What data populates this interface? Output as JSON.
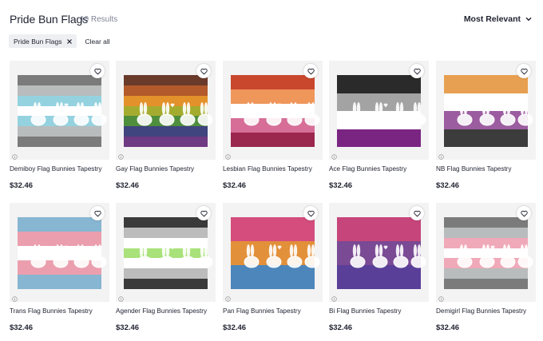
{
  "header": {
    "title": "Pride Bun Flags",
    "results": "10 Results",
    "sort_label": "Most Relevant"
  },
  "filters": {
    "chips": [
      {
        "label": "Pride Bun Flags"
      }
    ],
    "clear_label": "Clear all"
  },
  "products": [
    {
      "name": "Demiboy Flag Bunnies Tapestry",
      "price": "$32.46",
      "stripes": [
        "#7b7b7b",
        "#b8bcbc",
        "#95d2e0",
        "#ffffff",
        "#95d2e0",
        "#b8bcbc",
        "#7b7b7b"
      ]
    },
    {
      "name": "Gay Flag Bunnies Tapestry",
      "price": "$32.46",
      "stripes": [
        "#6a3a2a",
        "#b35a2c",
        "#e3912b",
        "#a4ac30",
        "#4f8e3c",
        "#40447f",
        "#6e3a82"
      ]
    },
    {
      "name": "Lesbian Flag Bunnies Tapestry",
      "price": "$32.46",
      "stripes": [
        "#c8472d",
        "#ef965b",
        "#ffffff",
        "#d66e98",
        "#9b264e"
      ]
    },
    {
      "name": "Ace Flag Bunnies Tapestry",
      "price": "$32.46",
      "stripes": [
        "#2a2a2a",
        "#a3a3a3",
        "#ffffff",
        "#7b2583"
      ]
    },
    {
      "name": "NB Flag Bunnies Tapestry",
      "price": "$32.46",
      "stripes": [
        "#e7a051",
        "#ffffff",
        "#9c5ca0",
        "#3d3c3c"
      ]
    },
    {
      "name": "Trans Flag Bunnies Tapestry",
      "price": "$32.46",
      "stripes": [
        "#86b6d1",
        "#eb9fae",
        "#ffffff",
        "#eb9fae",
        "#86b6d1"
      ]
    },
    {
      "name": "Agender Flag Bunnies Tapestry",
      "price": "$32.46",
      "stripes": [
        "#3a3a3a",
        "#bcbcbc",
        "#ffffff",
        "#a9e17a",
        "#ffffff",
        "#bcbcbc",
        "#3a3a3a"
      ]
    },
    {
      "name": "Pan Flag Bunnies Tapestry",
      "price": "$32.46",
      "stripes": [
        "#d44d7d",
        "#e3903a",
        "#4c86bb"
      ]
    },
    {
      "name": "Bi Flag Bunnies Tapestry",
      "price": "$32.46",
      "stripes": [
        "#c6457b",
        "#7a4a94",
        "#5a3f99"
      ]
    },
    {
      "name": "Demigirl Flag Bunnies Tapestry",
      "price": "$32.46",
      "stripes": [
        "#7b7b7b",
        "#b8bcbc",
        "#f0a9b8",
        "#ffffff",
        "#f0a9b8",
        "#b8bcbc",
        "#7b7b7b"
      ]
    }
  ],
  "icons": {
    "favorite": "heart-outline-icon",
    "info": "info-circle-icon",
    "sort": "chevron-down-icon",
    "remove_filter": "close-x-icon"
  }
}
